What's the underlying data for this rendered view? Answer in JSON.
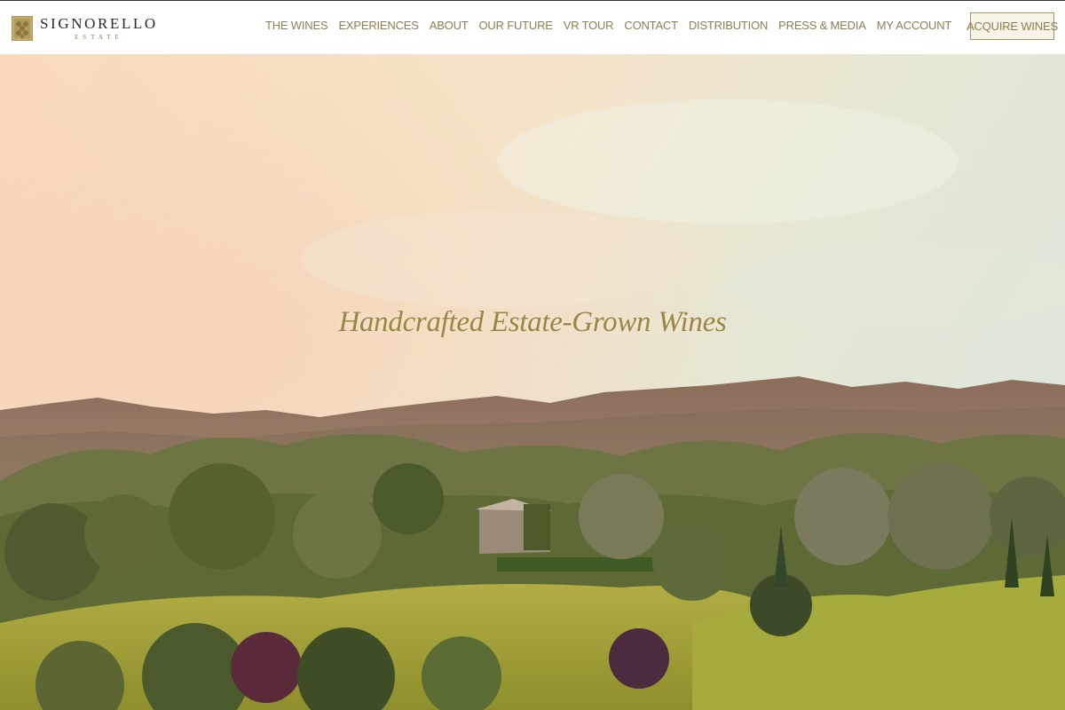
{
  "brand": {
    "name": "SIGNORELLO",
    "subtitle": "ESTATE",
    "logo_icon": "vine-crest-logo"
  },
  "nav": {
    "items": [
      {
        "label": "THE WINES"
      },
      {
        "label": "EXPERIENCES"
      },
      {
        "label": "ABOUT"
      },
      {
        "label": "OUR FUTURE"
      },
      {
        "label": "VR TOUR"
      },
      {
        "label": "CONTACT"
      },
      {
        "label": "DISTRIBUTION"
      },
      {
        "label": "PRESS & MEDIA"
      },
      {
        "label": "MY ACCOUNT"
      }
    ],
    "cta_label": "ACQUIRE WINES"
  },
  "hero": {
    "title": "Handcrafted Estate-Grown Wines"
  },
  "colors": {
    "accent_gold": "#8f7d52",
    "title_gold": "#9b8646",
    "header_bg": "#ffffff",
    "sky_peach": "#f6dcc0",
    "vineyard_green": "#a7a93a"
  }
}
